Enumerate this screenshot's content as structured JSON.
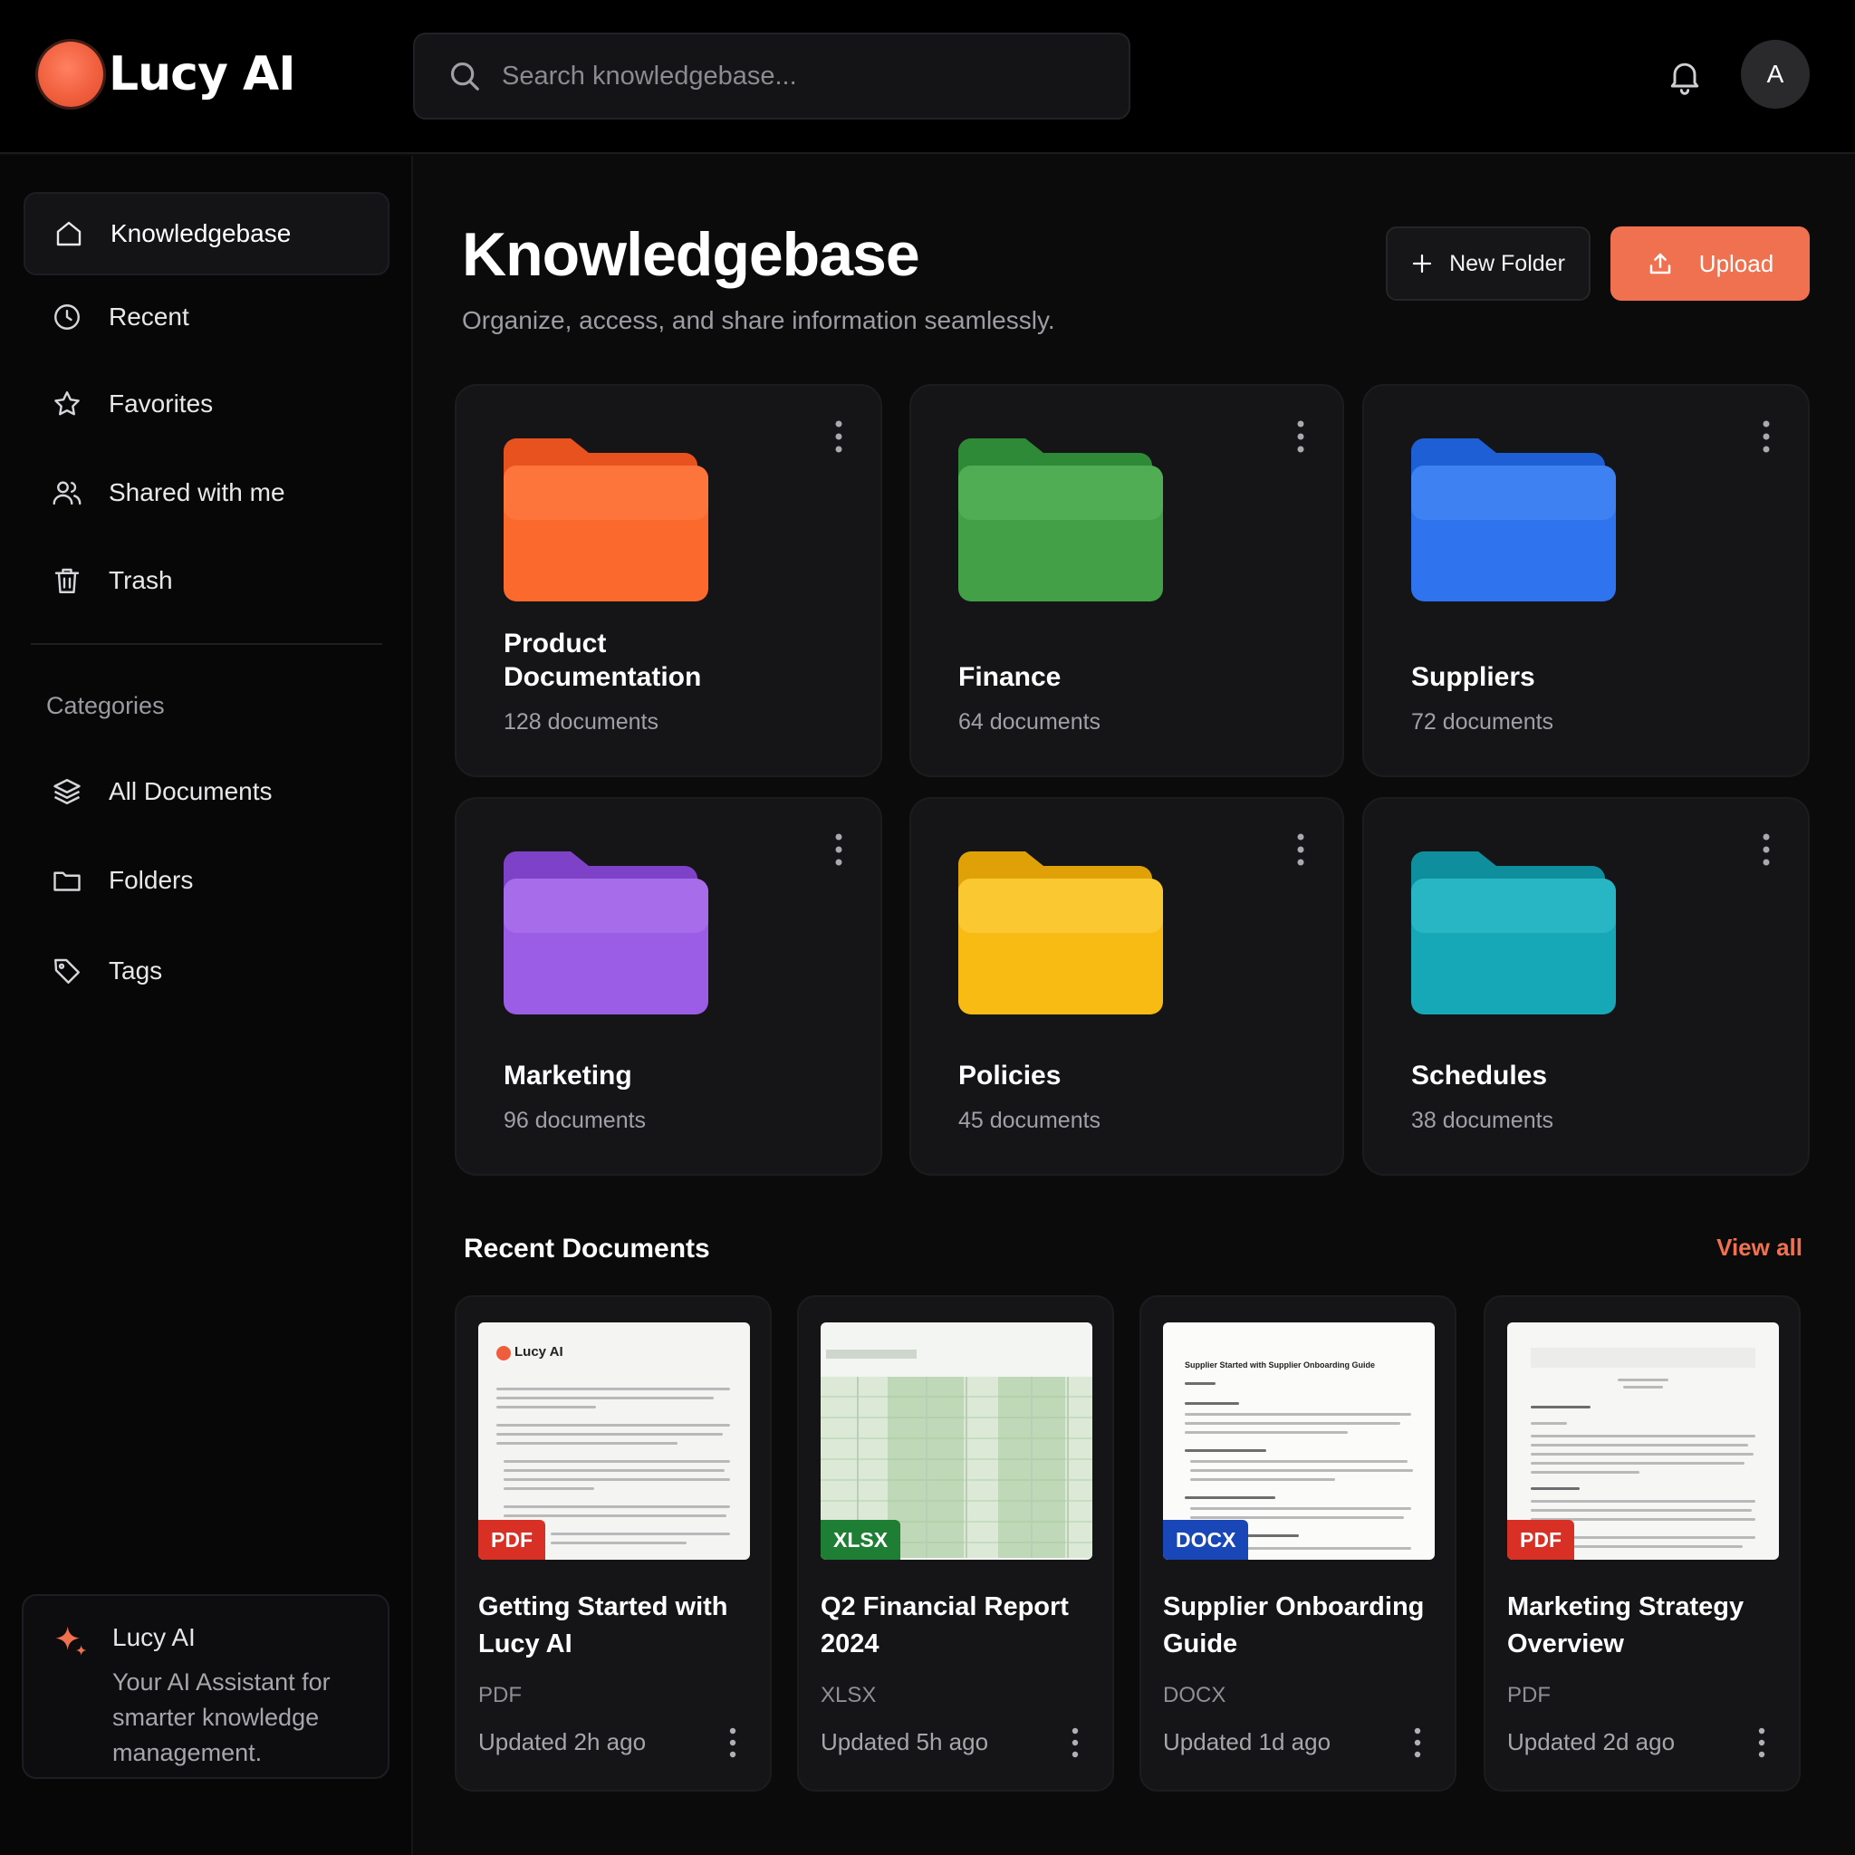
{
  "header": {
    "logo_text": "Lucy AI",
    "search_placeholder": "Search knowledgebase...",
    "avatar_initial": "A"
  },
  "sidebar": {
    "items": [
      {
        "label": "Knowledgebase",
        "icon": "home-icon",
        "active": true
      },
      {
        "label": "Recent",
        "icon": "clock-icon"
      },
      {
        "label": "Favorites",
        "icon": "star-icon"
      },
      {
        "label": "Shared with me",
        "icon": "users-icon"
      },
      {
        "label": "Trash",
        "icon": "trash-icon"
      }
    ],
    "categories_title": "Categories",
    "categories": [
      {
        "label": "All Documents",
        "icon": "layers-icon"
      },
      {
        "label": "Folders",
        "icon": "folder-outline-icon"
      },
      {
        "label": "Tags",
        "icon": "tag-icon"
      }
    ],
    "assistant": {
      "title": "Lucy AI",
      "description": "Your AI Assistant for smarter knowledge management."
    }
  },
  "main": {
    "title": "Knowledgebase",
    "subtitle": "Organize, access, and share information seamlessly.",
    "new_folder_label": "New Folder",
    "upload_label": "Upload",
    "folders": [
      {
        "name": "Product Documentation",
        "count": "128 documents",
        "color": "#fb6a2c"
      },
      {
        "name": "Finance",
        "count": "64 documents",
        "color": "#43a047"
      },
      {
        "name": "Suppliers",
        "count": "72 documents",
        "color": "#2f74ee"
      },
      {
        "name": "Marketing",
        "count": "96 documents",
        "color": "#9b5de5"
      },
      {
        "name": "Policies",
        "count": "45 documents",
        "color": "#f7bb13"
      },
      {
        "name": "Schedules",
        "count": "38 documents",
        "color": "#17a8b8"
      }
    ],
    "recent_title": "Recent Documents",
    "view_all_label": "View all",
    "documents": [
      {
        "title": "Getting Started with Lucy AI",
        "type": "PDF",
        "badge": "PDF",
        "badge_color": "#d93025",
        "updated": "Updated 2h ago",
        "thumb_heading": "Lucy AI"
      },
      {
        "title": "Q2 Financial Report 2024",
        "type": "XLSX",
        "badge": "XLSX",
        "badge_color": "#1e7e34",
        "updated": "Updated 5h ago"
      },
      {
        "title": "Supplier Onboarding Guide",
        "type": "DOCX",
        "badge": "DOCX",
        "badge_color": "#1a47b8",
        "updated": "Updated 1d ago",
        "thumb_heading": "Supplier Started with Supplier Onboarding Guide"
      },
      {
        "title": "Marketing Strategy Overview",
        "type": "PDF",
        "badge": "PDF",
        "badge_color": "#d93025",
        "updated": "Updated 2d ago"
      }
    ]
  }
}
